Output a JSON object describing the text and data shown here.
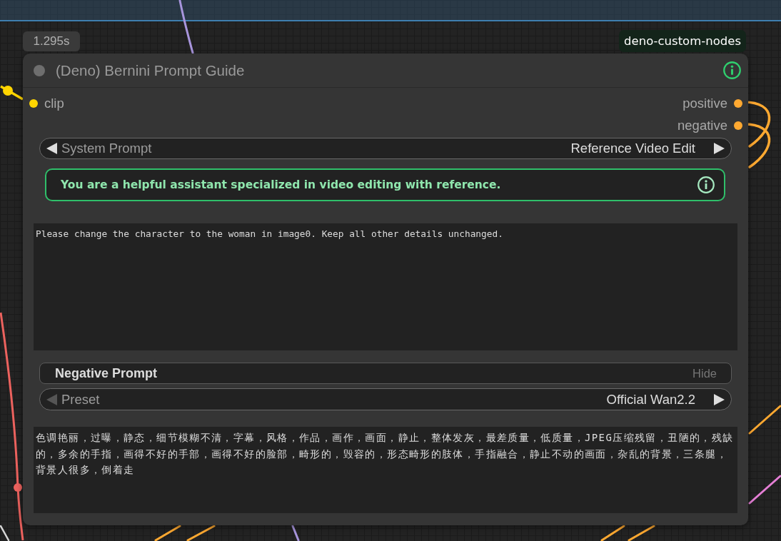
{
  "node": {
    "execution_time": "1.295s",
    "source_badge": "deno-custom-nodes",
    "title": "(Deno) Bernini Prompt Guide",
    "inputs": [
      {
        "label": "clip",
        "color": "#ffd500"
      }
    ],
    "outputs": [
      {
        "label": "positive",
        "color": "#ffa931"
      },
      {
        "label": "negative",
        "color": "#ffa931"
      }
    ],
    "system_prompt": {
      "label": "System Prompt",
      "value": "Reference Video Edit",
      "prev_disabled": false,
      "next_disabled": false
    },
    "info_box": {
      "text": "You are a helpful assistant specialized in video editing with reference."
    },
    "prompt": {
      "value": "Please change the character to the woman in image0. Keep all other details unchanged."
    },
    "negative_prompt": {
      "title": "Negative Prompt",
      "toggle": "Hide",
      "preset": {
        "label": "Preset",
        "value": "Official Wan2.2",
        "prev_disabled": true,
        "next_disabled": false
      },
      "value": "色调艳丽，过曝，静态，细节模糊不清，字幕，风格，作品，画作，画面，静止，整体发灰，最差质量，低质量，JPEG压缩残留，丑陋的，残缺的，多余的手指，画得不好的手部，画得不好的脸部，畸形的，毁容的，形态畸形的肢体，手指融合，静止不动的画面，杂乱的背景，三条腿，背景人很多，倒着走"
    }
  }
}
